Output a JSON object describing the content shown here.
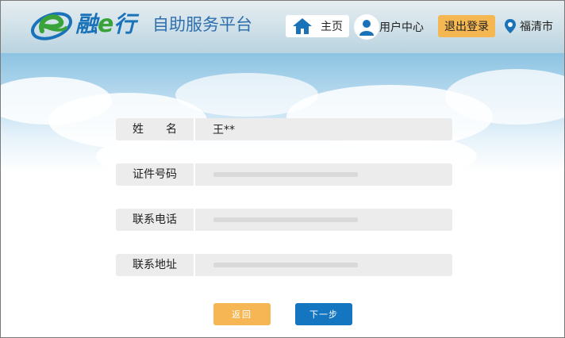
{
  "header": {
    "brand": {
      "part1": "融",
      "part2": "e",
      "part3": "行"
    },
    "platform_title": "自助服务平台",
    "nav": {
      "home_label": "主页",
      "user_center_label": "用户中心",
      "logout_label": "退出登录",
      "city_label": "福清市"
    },
    "colors": {
      "brand_blue": "#1a73b9",
      "brand_green": "#3aa23a",
      "logout_bg": "#f4b752"
    }
  },
  "form": {
    "rows": [
      {
        "label": "姓　　名",
        "value": "王**"
      },
      {
        "label": "证件号码",
        "value": ""
      },
      {
        "label": "联系电话",
        "value": ""
      },
      {
        "label": "联系地址",
        "value": ""
      }
    ]
  },
  "actions": {
    "back_label": "返回",
    "next_label": "下一步",
    "colors": {
      "back_bg": "#f5b653",
      "next_bg": "#1476c0"
    }
  },
  "icons": {
    "logo": "swoosh-e-logo-icon",
    "home": "house-icon",
    "user": "user-avatar-icon",
    "location": "location-pin-icon"
  }
}
